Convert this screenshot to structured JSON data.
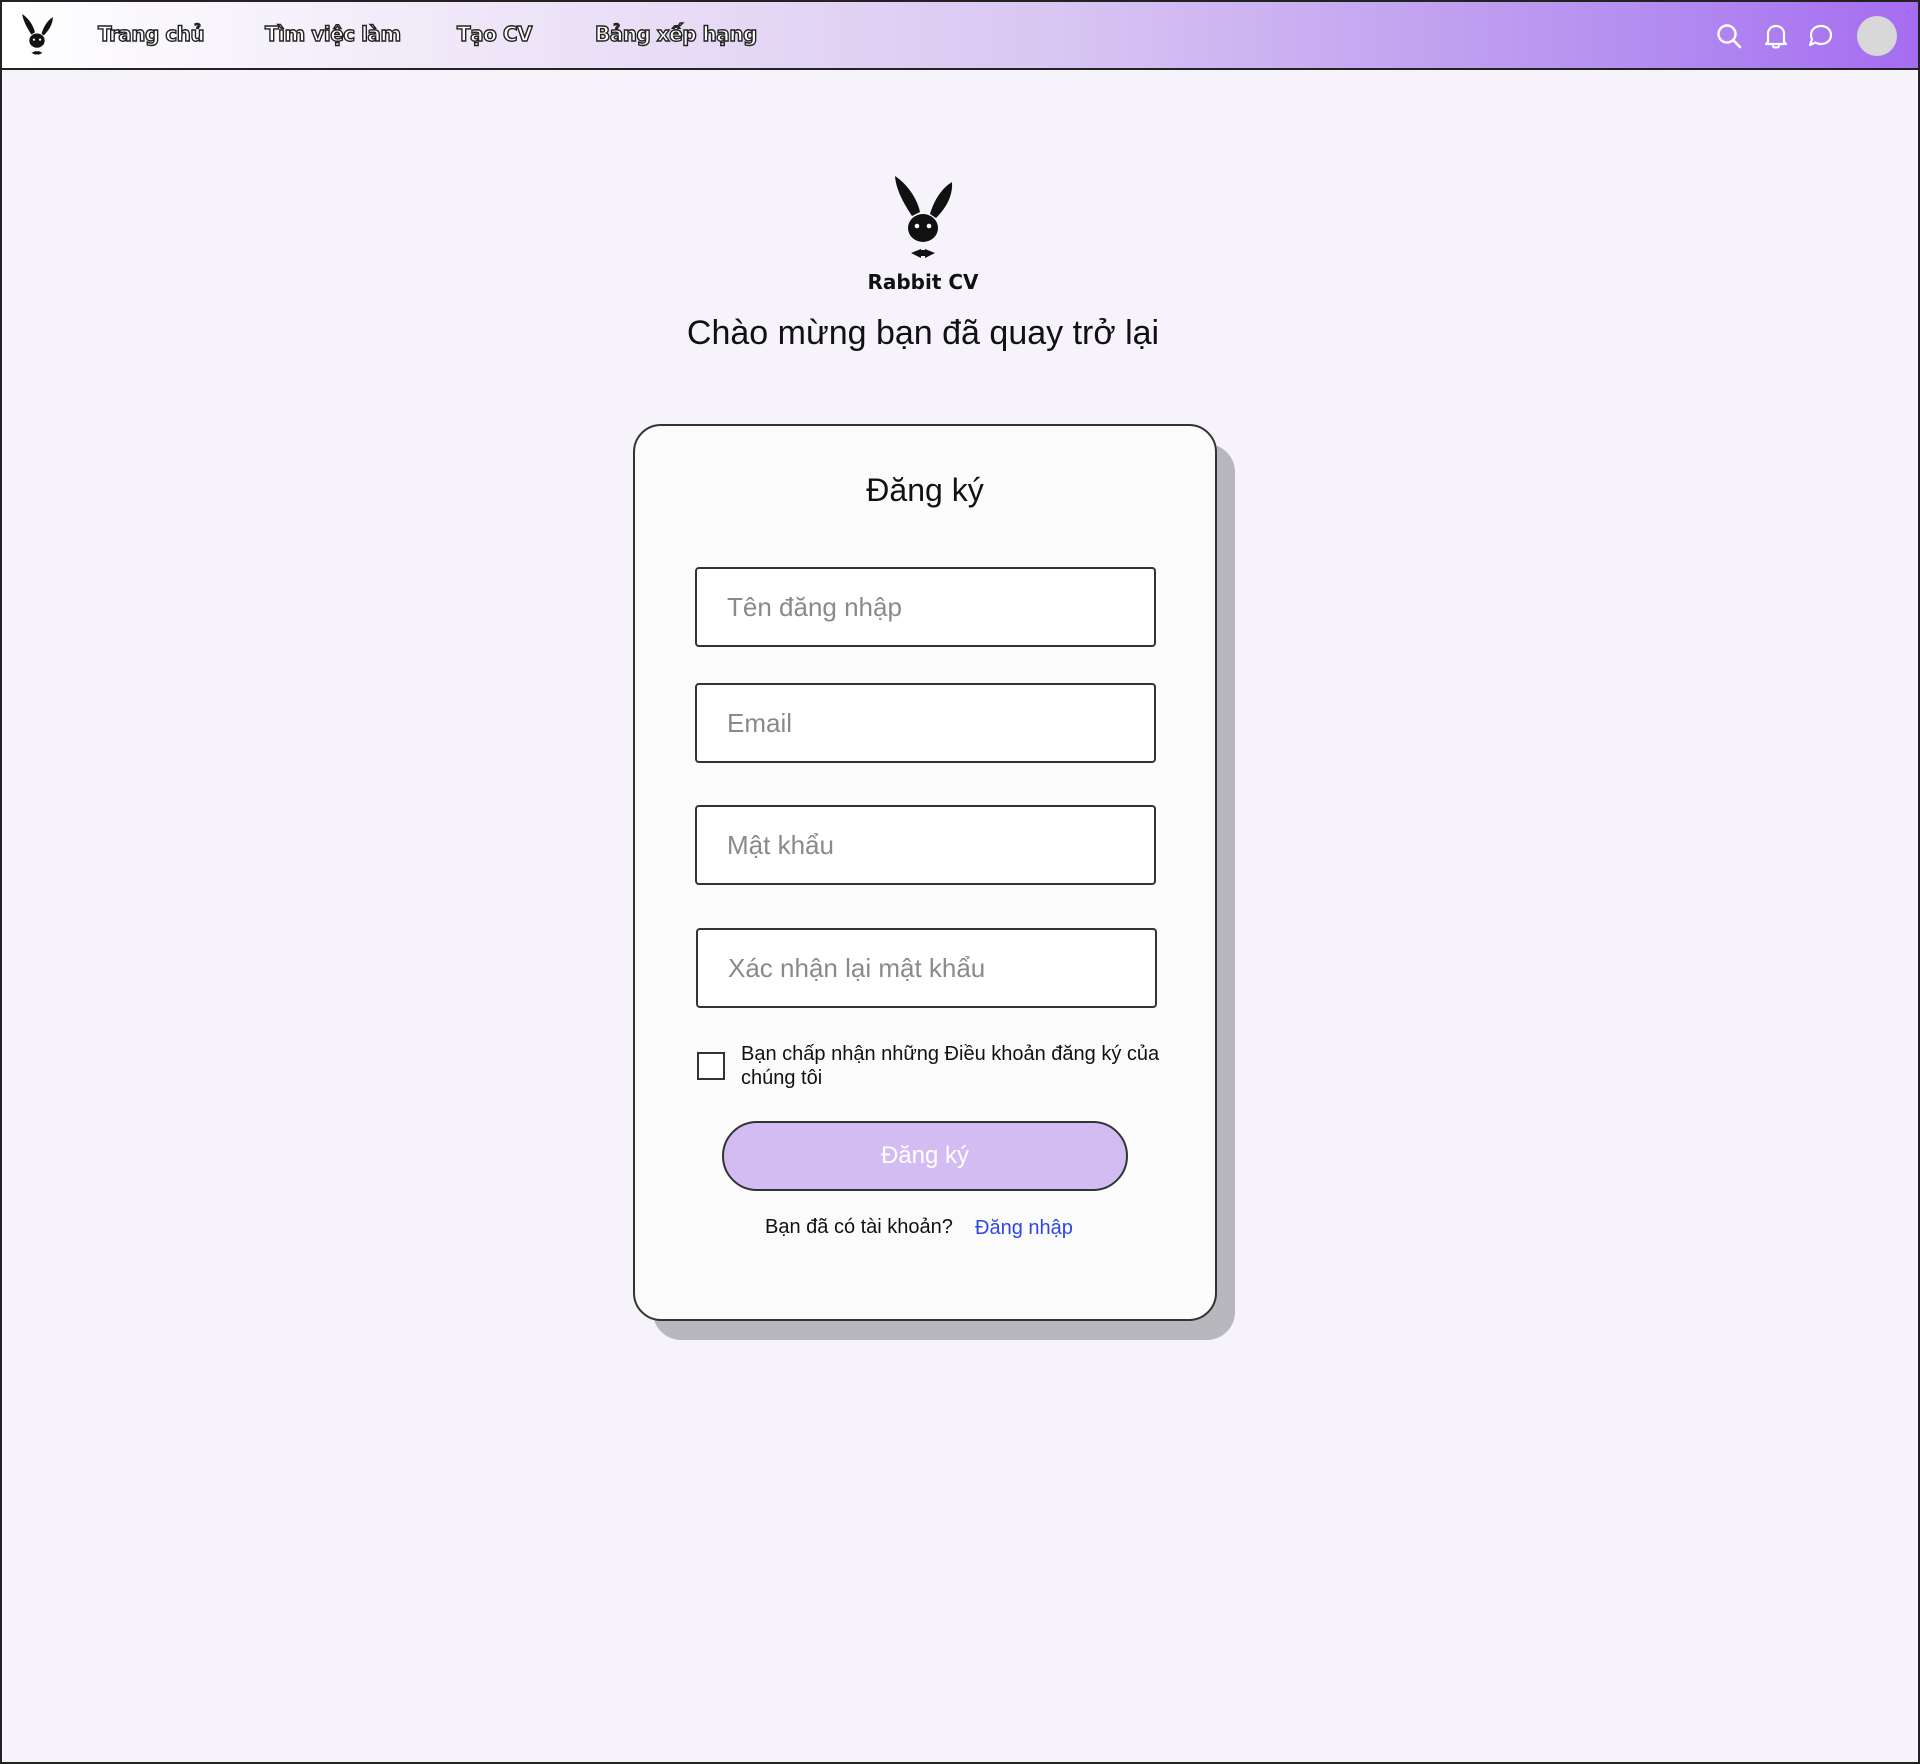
{
  "nav": {
    "links": [
      "Trang chủ",
      "Tìm việc làm",
      "Tạo CV",
      "Bảng xếp hạng"
    ],
    "icons": [
      "search-icon",
      "bell-icon",
      "chat-icon",
      "avatar"
    ]
  },
  "brand": {
    "name": "Rabbit CV",
    "welcome": "Chào mừng bạn đã quay trở lại"
  },
  "form": {
    "title": "Đăng ký",
    "username_placeholder": "Tên đăng nhập",
    "email_placeholder": "Email",
    "password_placeholder": "Mật khẩu",
    "confirm_password_placeholder": "Xác nhận lại mật khẩu",
    "terms_label": "Bạn chấp nhận những Điều khoản đăng ký của chúng tôi",
    "terms_checked": false,
    "submit_label": "Đăng ký",
    "have_account_text": "Bạn đã có tài khoản?",
    "login_link": "Đăng nhập"
  },
  "colors": {
    "accent": "#a56cf0",
    "button_bg": "#d3bcf2",
    "link": "#2f47e0",
    "page_bg": "#f6f3fa"
  }
}
